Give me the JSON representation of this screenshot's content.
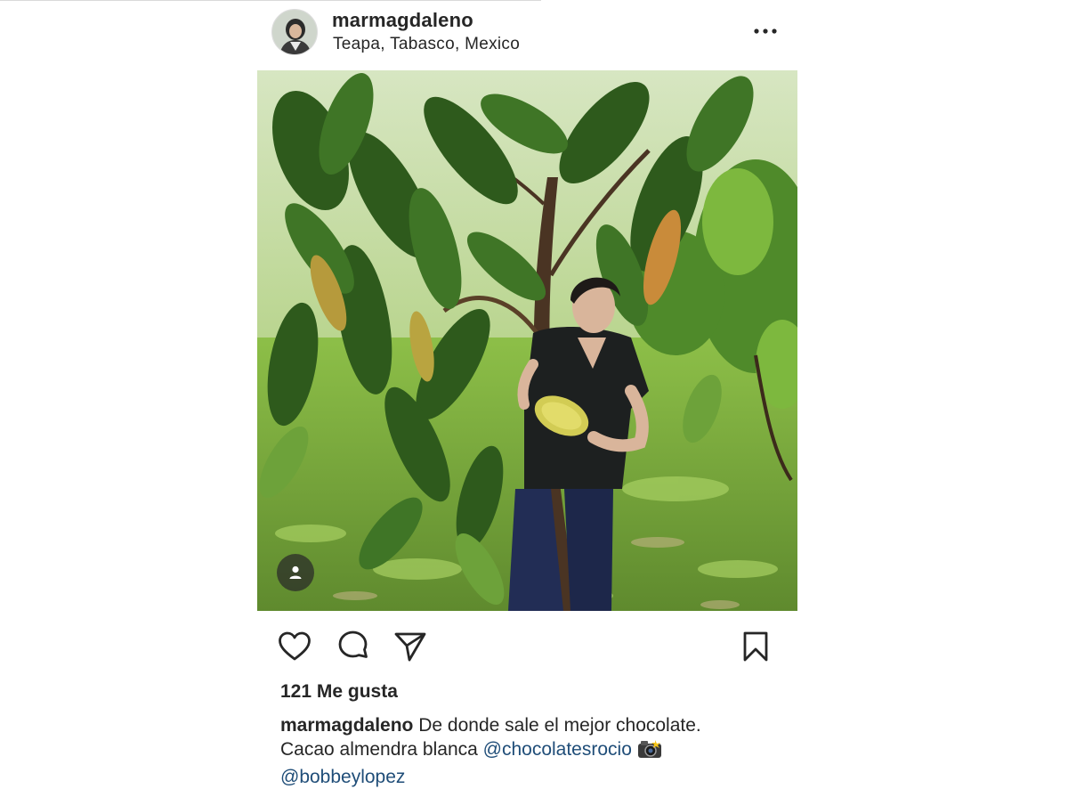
{
  "post": {
    "username": "marmagdaleno",
    "location": "Teapa, Tabasco, Mexico",
    "likes_text": "121 Me gusta",
    "caption_username": "marmagdaleno",
    "caption_text_1": " De donde sale el mejor chocolate.",
    "caption_text_2": "Cacao almendra blanca ",
    "mention_1": "@chocolatesrocio",
    "mention_2": "@bobbeylopez"
  },
  "icons": {
    "more": "more-options-icon",
    "like": "heart-icon",
    "comment": "comment-icon",
    "share": "paper-plane-icon",
    "save": "bookmark-icon",
    "tag": "user-tag-icon",
    "camera": "camera-flash-emoji"
  },
  "colors": {
    "text": "#262626",
    "mention": "#1f4d78",
    "leaf_dark": "#2e5a1c",
    "leaf_light": "#8fc04a"
  }
}
